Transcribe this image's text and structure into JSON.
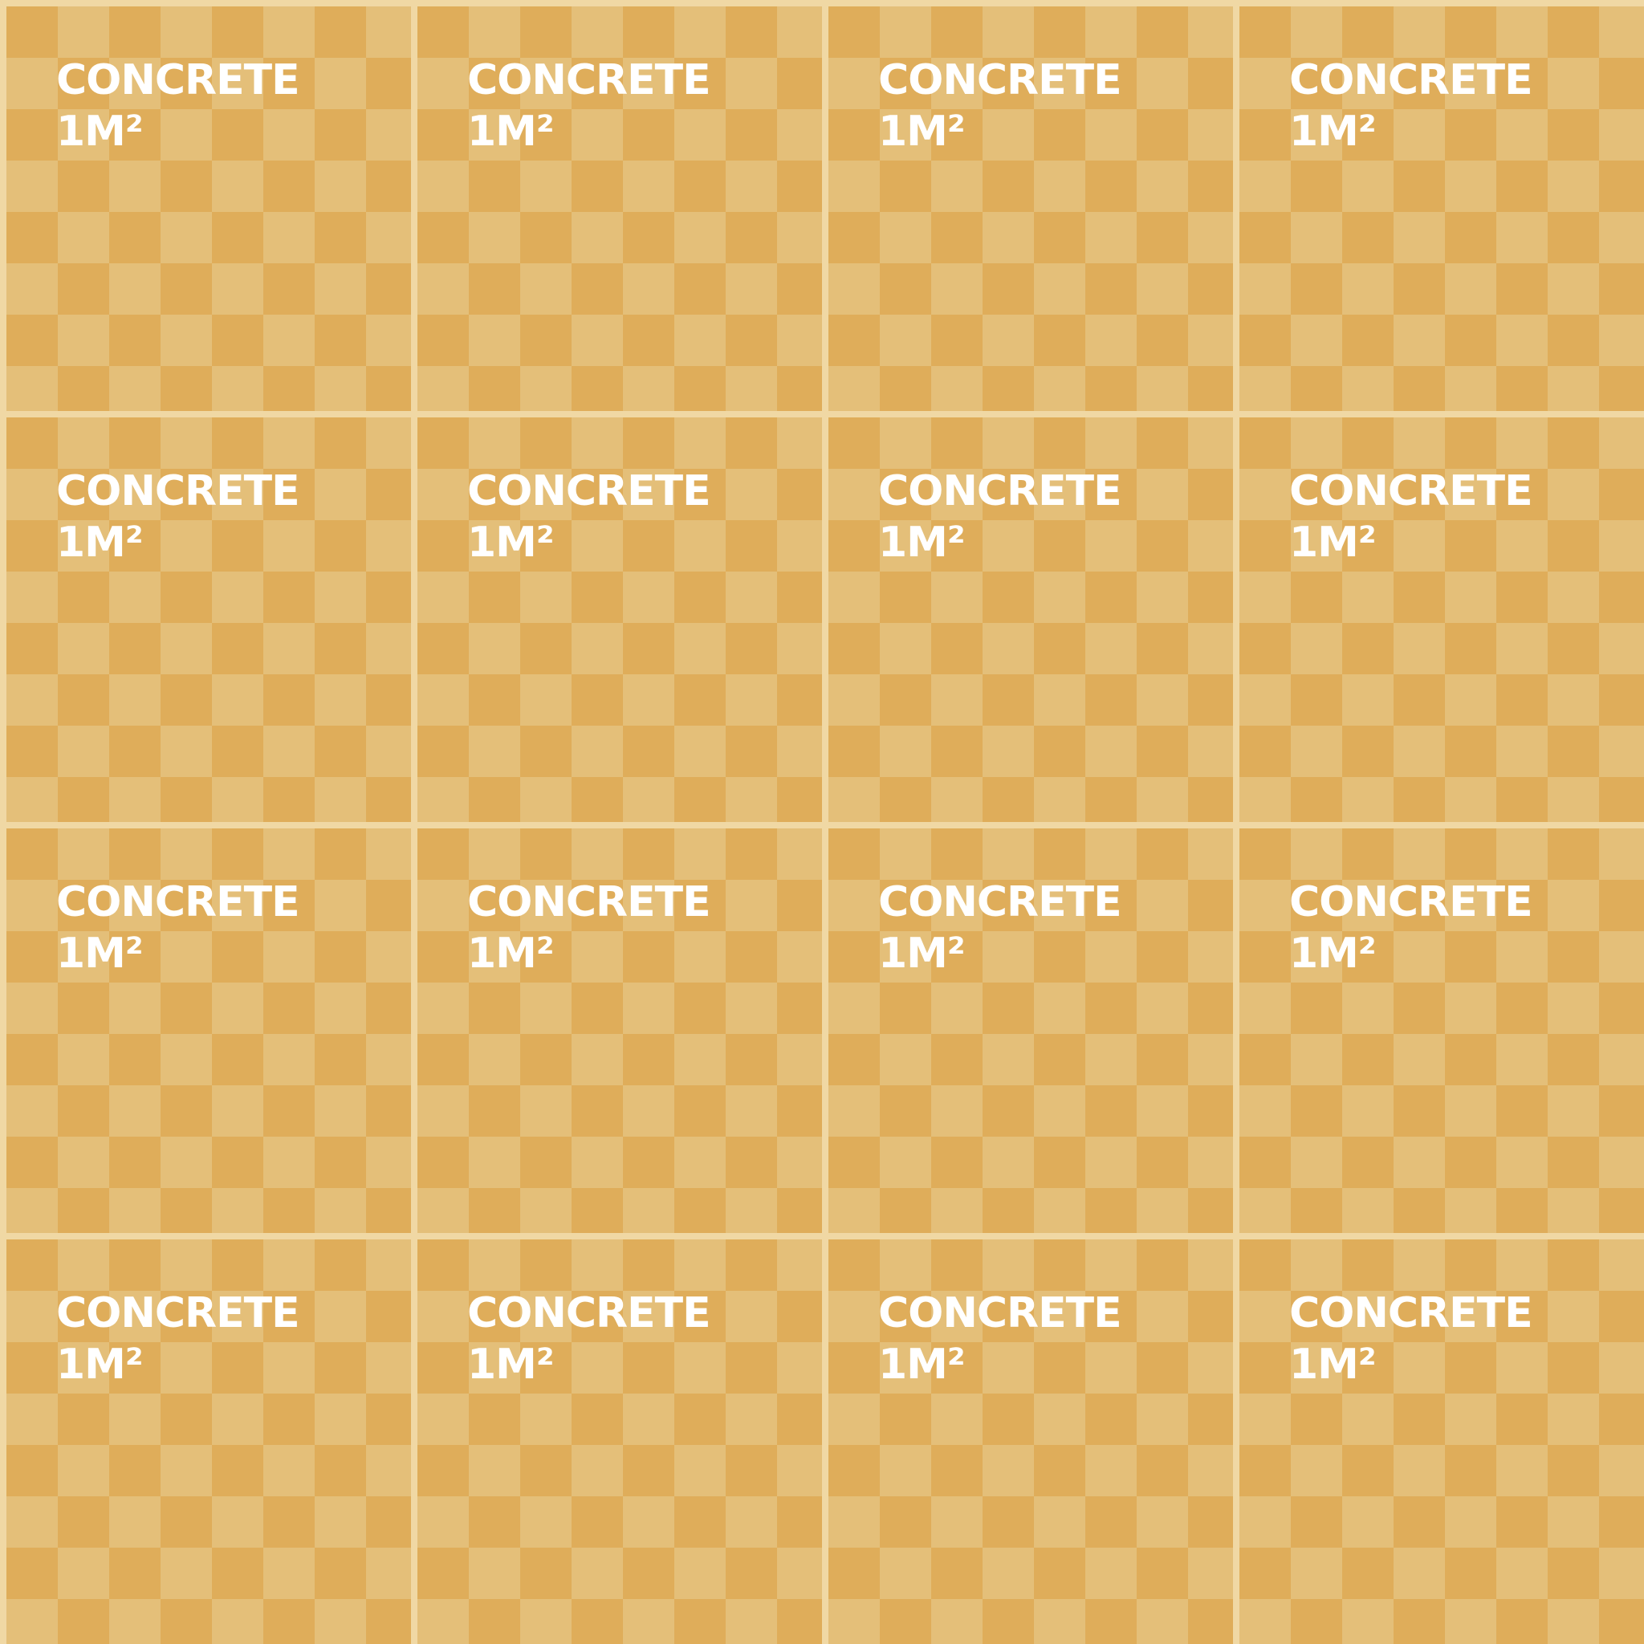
{
  "tiles": [
    {
      "material": "CONCRETE",
      "size": "1M²"
    },
    {
      "material": "CONCRETE",
      "size": "1M²"
    },
    {
      "material": "CONCRETE",
      "size": "1M²"
    },
    {
      "material": "CONCRETE",
      "size": "1M²"
    },
    {
      "material": "CONCRETE",
      "size": "1M²"
    },
    {
      "material": "CONCRETE",
      "size": "1M²"
    },
    {
      "material": "CONCRETE",
      "size": "1M²"
    },
    {
      "material": "CONCRETE",
      "size": "1M²"
    },
    {
      "material": "CONCRETE",
      "size": "1M²"
    },
    {
      "material": "CONCRETE",
      "size": "1M²"
    },
    {
      "material": "CONCRETE",
      "size": "1M²"
    },
    {
      "material": "CONCRETE",
      "size": "1M²"
    },
    {
      "material": "CONCRETE",
      "size": "1M²"
    },
    {
      "material": "CONCRETE",
      "size": "1M²"
    },
    {
      "material": "CONCRETE",
      "size": "1M²"
    },
    {
      "material": "CONCRETE",
      "size": "1M²"
    }
  ],
  "colors": {
    "grout": "#f0d8a4",
    "checker_dark": "#dfad5a",
    "checker_light": "#e4bf79",
    "text": "#ffffff"
  }
}
